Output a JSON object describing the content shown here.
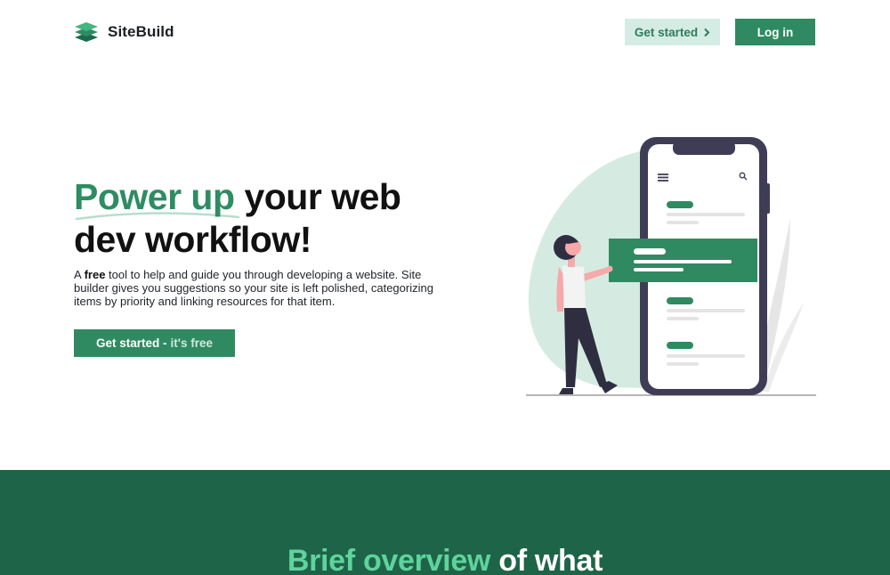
{
  "header": {
    "brand": "SiteBuild",
    "get_started_label": "Get started",
    "login_label": "Log in"
  },
  "hero": {
    "title_highlight": "Power up",
    "title_rest_line1": "your web",
    "title_line2": "dev workflow!",
    "desc_prefix": "A ",
    "desc_bold": "free",
    "desc_rest": " tool to help and guide you through developing a website. Site builder gives you suggestions so your site is left polished, categorizing items by priority and linking resources for that item.",
    "cta_main": "Get started -",
    "cta_suffix": "it's free"
  },
  "overview": {
    "title_highlight": "Brief overview",
    "title_rest": "of what"
  },
  "colors": {
    "brand_green": "#2f8a61",
    "light_green": "#d4ece3",
    "dark_section": "#1e6448",
    "accent_text": "#5fd39c"
  },
  "icons": {
    "logo": "stacked-layers-icon",
    "chevron": "chevron-right-icon",
    "menu": "hamburger-icon",
    "search": "search-icon"
  }
}
